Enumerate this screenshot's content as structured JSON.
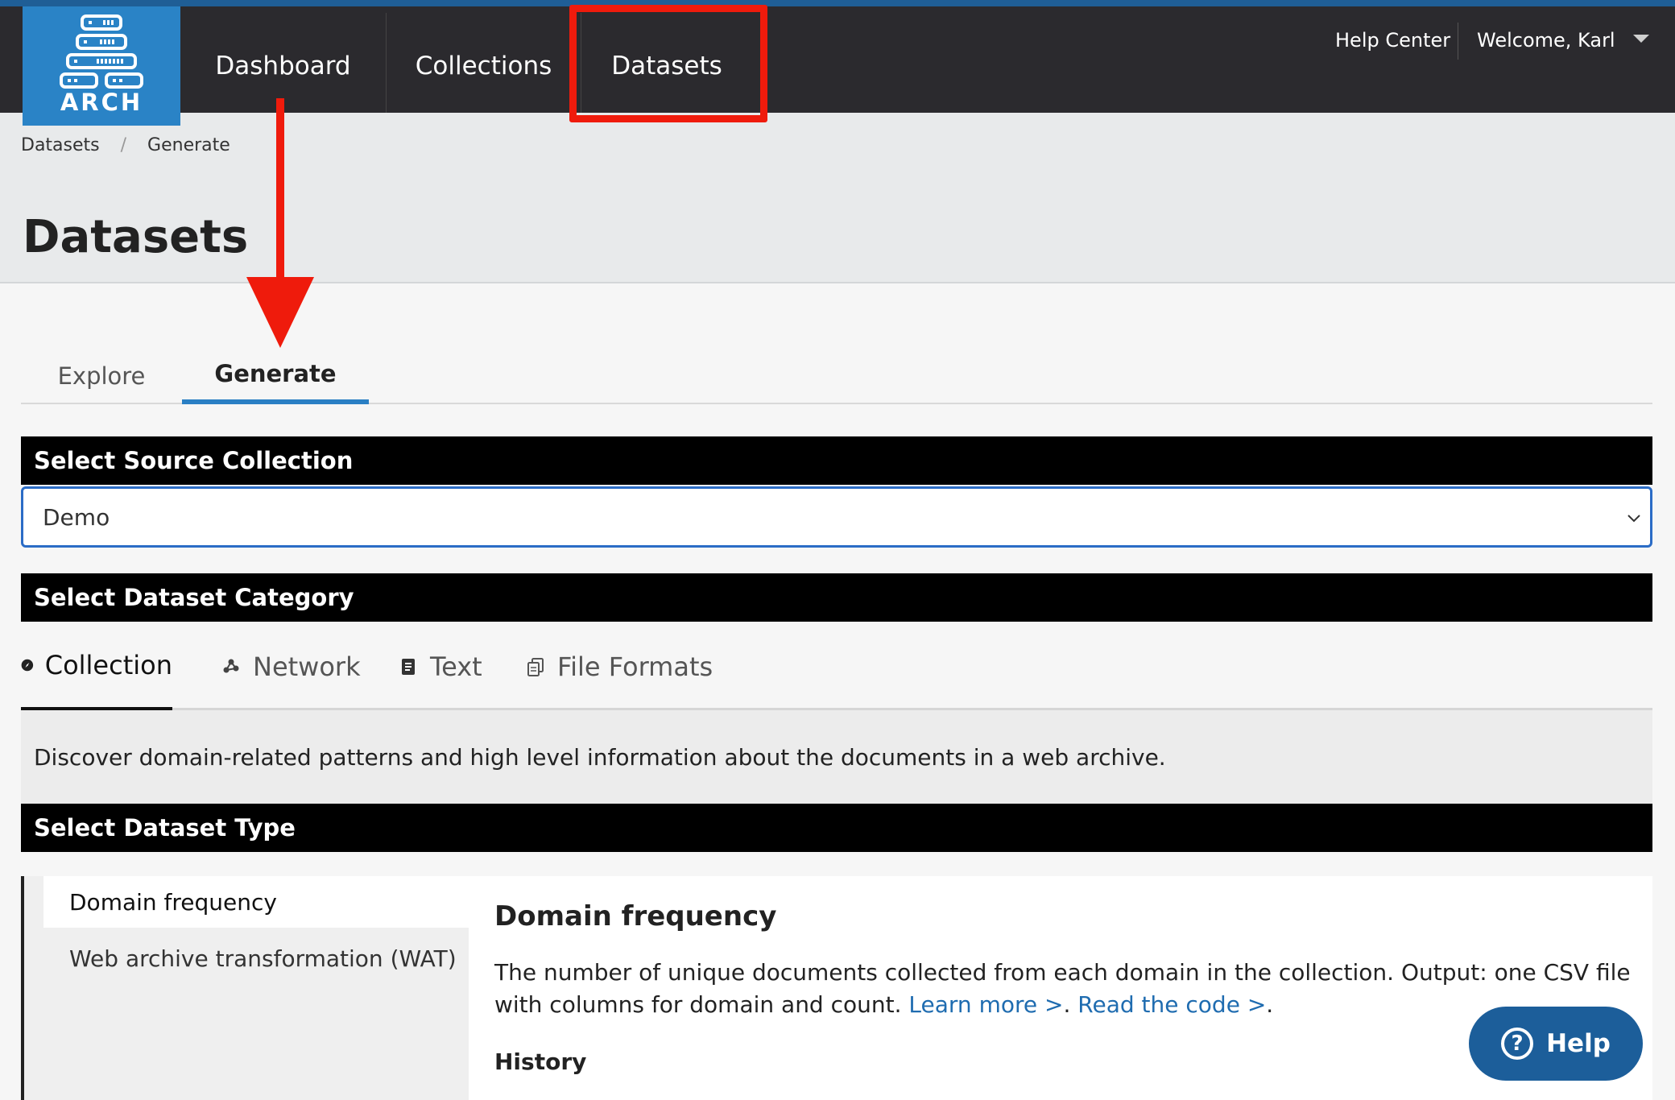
{
  "nav": {
    "logo_text": "ARCH",
    "items": [
      {
        "label": "Dashboard"
      },
      {
        "label": "Collections"
      },
      {
        "label": "Datasets"
      }
    ],
    "help_center": "Help Center",
    "welcome": "Welcome, Karl"
  },
  "breadcrumb": {
    "items": [
      "Datasets",
      "Generate"
    ],
    "separator": "/"
  },
  "page": {
    "title": "Datasets"
  },
  "tabs": [
    {
      "label": "Explore",
      "active": false
    },
    {
      "label": "Generate",
      "active": true
    }
  ],
  "source": {
    "heading": "Select Source Collection",
    "selected": "Demo"
  },
  "category": {
    "heading": "Select Dataset Category",
    "tabs": [
      {
        "label": "Collection",
        "icon": "compass-icon",
        "active": true
      },
      {
        "label": "Network",
        "icon": "network-icon",
        "active": false
      },
      {
        "label": "Text",
        "icon": "document-icon",
        "active": false
      },
      {
        "label": "File Formats",
        "icon": "file-formats-icon",
        "active": false
      }
    ],
    "description": "Discover domain-related patterns and high level information about the documents in a web archive."
  },
  "dataset_type": {
    "heading": "Select Dataset Type",
    "items": [
      {
        "label": "Domain frequency",
        "active": true
      },
      {
        "label": "Web archive transformation (WAT)",
        "active": false
      }
    ],
    "detail": {
      "title": "Domain frequency",
      "text": "The number of unique documents collected from each domain in the collection. Output: one CSV file with columns for domain and count.",
      "learn_more": "Learn more >",
      "read_code": "Read the code >",
      "history": "History"
    }
  },
  "help_button": {
    "label": "Help",
    "glyph": "?"
  },
  "colors": {
    "nav_bg": "#2b2a2e",
    "logo_bg": "#2a83c6",
    "accent": "#2a7fc4",
    "highlight": "#ef1b0c",
    "help_bg": "#1c5e9a",
    "link": "#1f6cb0"
  }
}
